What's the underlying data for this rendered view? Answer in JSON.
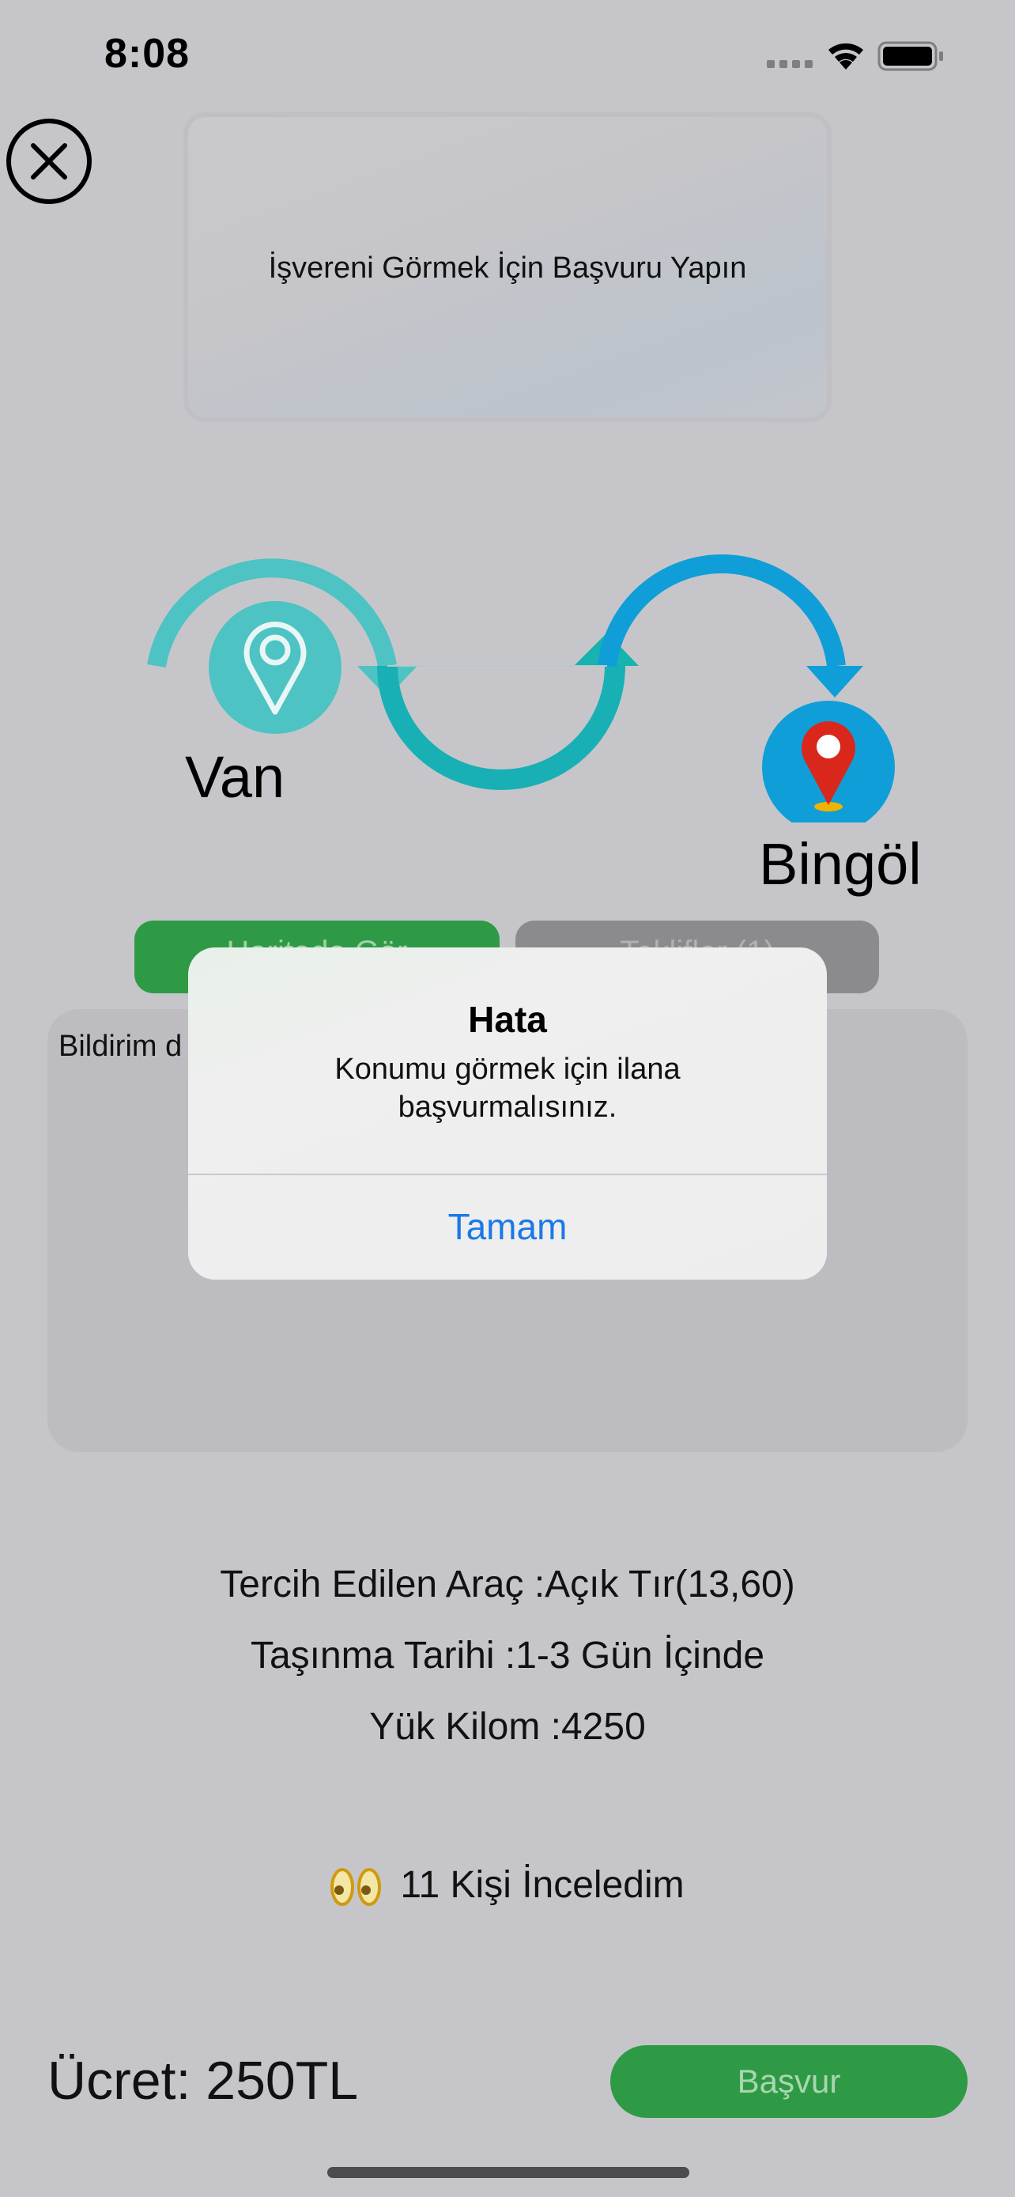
{
  "status": {
    "time": "8:08"
  },
  "employer": {
    "message": "İşvereni Görmek İçin Başvuru Yapın"
  },
  "route": {
    "from": "Van",
    "to": "Bingöl"
  },
  "tabs": {
    "left": "Haritada Gör",
    "right": "Teklifler (1)"
  },
  "notification": {
    "label": "Bildirim d"
  },
  "details": {
    "vehicle": "Tercih Edilen Araç :Açık Tır(13,60)",
    "date": "Taşınma Tarihi :1-3 Gün İçinde",
    "weight": "Yük Kilom :4250"
  },
  "views": {
    "text": "11 Kişi İnceledim"
  },
  "footer": {
    "price": "Ücret: 250TL",
    "apply": "Başvur"
  },
  "alert": {
    "title": "Hata",
    "message": "Konumu görmek için ilana başvurmalısınız.",
    "ok": "Tamam"
  },
  "colors": {
    "accent_green": "#2f9a45",
    "alert_blue": "#1b79e6",
    "teal": "#4dc3c3",
    "blue": "#109ed8",
    "pin_red": "#d9271c"
  }
}
